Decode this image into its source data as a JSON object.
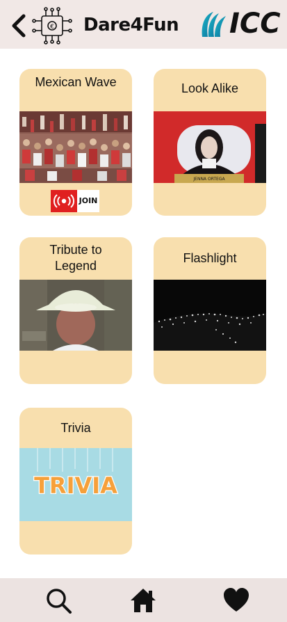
{
  "header": {
    "brand": "Dare4Fun",
    "partner_logo_text": "ICC",
    "icons": [
      "chevron-left-icon",
      "circuit-chip-icon",
      "icc-logo"
    ]
  },
  "cards": [
    {
      "title": "Mexican Wave",
      "image": "stadium crowd photo",
      "join_label": "JOIN"
    },
    {
      "title": "Look Alike",
      "image": "jumbotron portrait",
      "screen_caption": "JENNA ORTEGA"
    },
    {
      "title": "Tribute to Legend",
      "image": "photo mosaic of cricketer"
    },
    {
      "title": "Flashlight",
      "image": "stadium phone lights at night"
    },
    {
      "title": "Trivia",
      "image": "trivia banner",
      "banner_text": "TRIVIA"
    }
  ],
  "bottom_nav": {
    "items": [
      {
        "icon": "search-icon"
      },
      {
        "icon": "home-icon"
      },
      {
        "icon": "heart-icon"
      }
    ]
  },
  "colors": {
    "header_bg": "#f1e8e6",
    "card_bg": "#f8dfae",
    "nav_bg": "#ece3e1",
    "live_red": "#e02020"
  }
}
